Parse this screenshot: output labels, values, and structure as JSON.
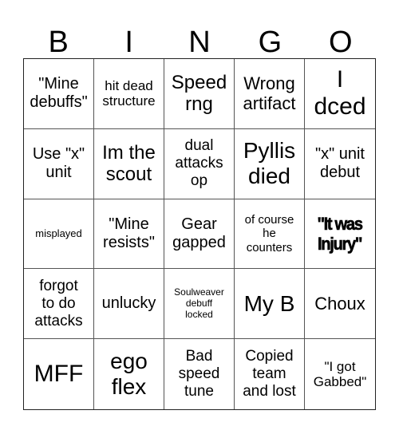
{
  "header": {
    "letters": [
      "B",
      "I",
      "N",
      "G",
      "O"
    ]
  },
  "card": {
    "rows": [
      [
        "\"Mine\ndebuffs\"",
        "hit dead\nstructure",
        "Speed\nrng",
        "Wrong\nartifact",
        "I\ndced"
      ],
      [
        "Use \"x\"\nunit",
        "Im the\nscout",
        "dual\nattacks\nop",
        "Pyllis\ndied",
        "\"x\" unit\ndebut"
      ],
      [
        "misplayed",
        "\"Mine\nresists\"",
        "Gear\ngapped",
        "of course\nhe\ncounters",
        "\"It was\nInjury\""
      ],
      [
        "forgot\nto do\nattacks",
        "unlucky",
        "Soulweaver\ndebuff\nlocked",
        "My B",
        "Choux"
      ],
      [
        "MFF",
        "ego\nflex",
        "Bad\nspeed\ntune",
        "Copied\nteam\nand lost",
        "\"I got\nGabbed\""
      ]
    ]
  }
}
